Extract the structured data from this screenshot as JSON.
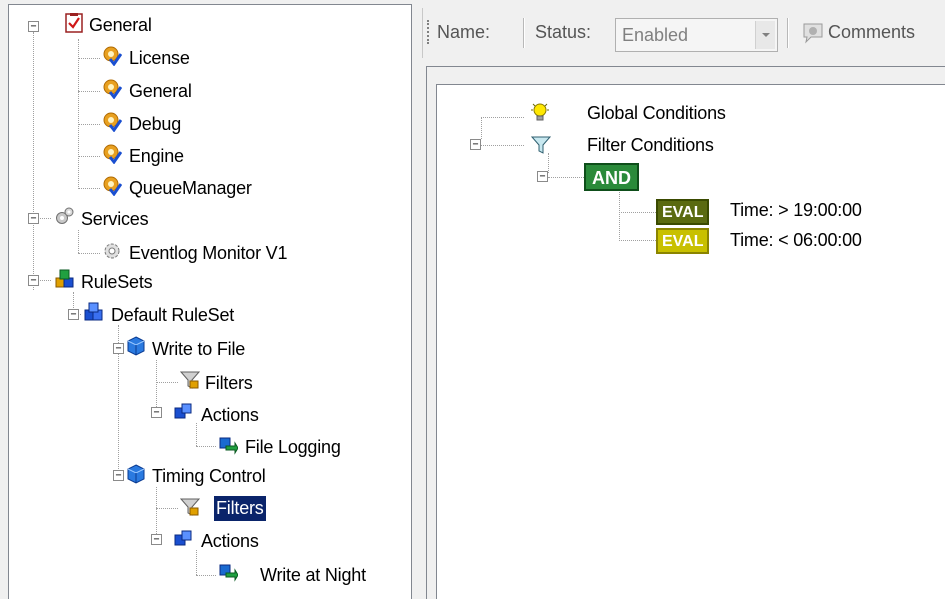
{
  "tree": {
    "general": "General",
    "license": "License",
    "general_sub": "General",
    "debug": "Debug",
    "engine": "Engine",
    "queue_manager": "QueueManager",
    "services": "Services",
    "eventlog_monitor": "Eventlog Monitor V1",
    "rulesets": "RuleSets",
    "default_ruleset": "Default RuleSet",
    "write_to_file": "Write to File",
    "filters_1": "Filters",
    "actions_1": "Actions",
    "file_logging": "File Logging",
    "timing_control": "Timing Control",
    "filters_2": "Filters",
    "actions_2": "Actions",
    "write_at_night": "Write at Night"
  },
  "toolbar": {
    "name_label": "Name:",
    "status_label": "Status:",
    "status_value": "Enabled",
    "comments_label": "Comments"
  },
  "conditions": {
    "global": "Global Conditions",
    "filter": "Filter Conditions",
    "and_label": "AND",
    "eval_label": "EVAL",
    "cond1": "Time:  >  19:00:00",
    "cond2": "Time:  <  06:00:00"
  },
  "colors": {
    "selection": "#0a246a",
    "and_badge": "#2a8a3a",
    "eval_dark": "#5a6a10",
    "eval_yellow": "#c8c000"
  }
}
